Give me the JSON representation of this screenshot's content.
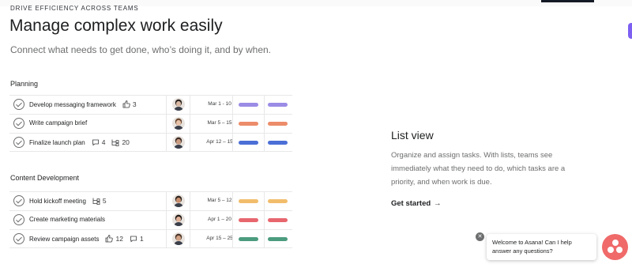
{
  "header": {
    "eyebrow": "DRIVE EFFICIENCY ACROSS TEAMS",
    "headline": "Manage complex work easily",
    "subhead": "Connect what needs to get done, who’s doing it, and by when."
  },
  "planning": {
    "title": "Planning",
    "rows": [
      {
        "task": "Develop messaging framework",
        "meta": [
          {
            "icon": "thumbs-up-icon",
            "value": "3"
          }
        ],
        "date": "Mar 1 - 10",
        "pills": [
          "#9b8ce6",
          "#9b8ce6"
        ]
      },
      {
        "task": "Write campaign brief",
        "meta": [],
        "date": "Mar 5 – 15",
        "pills": [
          "#ec8c6a",
          "#ec8c6a"
        ]
      },
      {
        "task": "Finalize launch plan",
        "meta": [
          {
            "icon": "comment-icon",
            "value": "4"
          },
          {
            "icon": "subtask-icon",
            "value": "20"
          }
        ],
        "date": "Apr 12 – 15",
        "pills": [
          "#4b6fd6",
          "#4b6fd6"
        ]
      }
    ]
  },
  "content_development": {
    "title": "Content Development",
    "rows": [
      {
        "task": "Hold kickoff meeting",
        "meta": [
          {
            "icon": "subtask-icon",
            "value": "5"
          }
        ],
        "date": "Mar 5 – 12",
        "pills": [
          "#f1bd6c",
          "#f1bd6c"
        ]
      },
      {
        "task": "Create marketing materials",
        "meta": [],
        "date": "Apr 1 – 20",
        "pills": [
          "#e8676f",
          "#e8676f"
        ]
      },
      {
        "task": "Review campaign assets",
        "meta": [
          {
            "icon": "thumbs-up-icon",
            "value": "12"
          },
          {
            "icon": "comment-icon",
            "value": "1"
          }
        ],
        "date": "Apr 15 – 25",
        "pills": [
          "#4c9c7f",
          "#4c9c7f"
        ]
      }
    ]
  },
  "list_view": {
    "title": "List view",
    "description": "Organize and assign tasks. With lists, teams see immediately what they need to do, which tasks are a priority, and when work is due.",
    "cta": "Get started",
    "cta_arrow": "→"
  },
  "chat": {
    "close": "✕",
    "message": "Welcome to Asana! Can I help answer any questions?"
  },
  "colors": {
    "accent_purple": "#7d60f2",
    "chat_coral": "#f06a6a"
  }
}
